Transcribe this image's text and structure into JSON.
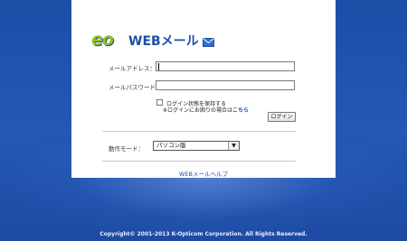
{
  "logo": {
    "brand": "eo",
    "title": "WEBメール"
  },
  "form": {
    "address_label": "メールアドレス：",
    "address_value": "",
    "password_label": "メールパスワード：",
    "password_value": "",
    "remember_label": "ログイン状態を保持する",
    "forgot_prefix": "※ログインにお困りの場合は",
    "forgot_link": "こちら",
    "login_button": "ログイン",
    "mode_label": "動作モード：",
    "mode_selected": "パソコン版"
  },
  "help_link": "WEBメールヘルプ",
  "footer": {
    "copyright": "Copyright© 2001-2013 K-Opticom Corporation. All Rights Reserved."
  },
  "colors": {
    "background": "#2458b4",
    "brand_blue": "#1e4fa8",
    "brand_green": "#8dc21f"
  },
  "icons": {
    "mail": "envelope-icon",
    "dropdown": "chevron-down-icon"
  }
}
